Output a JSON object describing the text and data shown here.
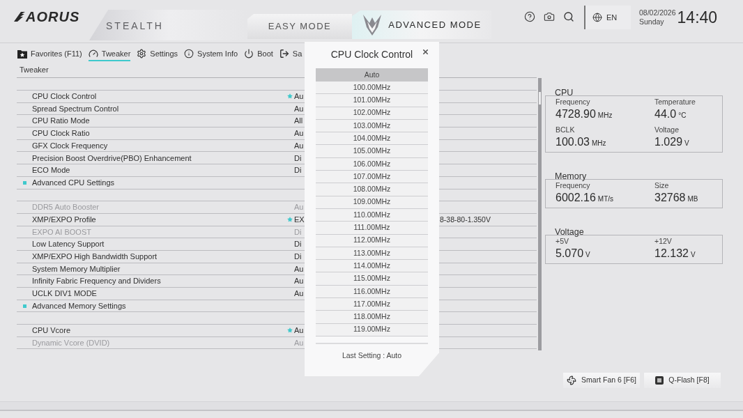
{
  "header": {
    "logo": "AORUS",
    "edition": "STEALTH",
    "modes": [
      {
        "label": "EASY MODE",
        "selected": false
      },
      {
        "label": "ADVANCED MODE",
        "selected": true
      }
    ],
    "language": "EN",
    "date": "08/02/2026",
    "weekday": "Sunday",
    "time": "14:40"
  },
  "nav_tabs": [
    {
      "kind": "favorites",
      "label": "Favorites (F11)",
      "selected": false
    },
    {
      "kind": "tweaker",
      "label": "Tweaker",
      "selected": true
    },
    {
      "kind": "settings",
      "label": "Settings",
      "selected": false
    },
    {
      "kind": "info",
      "label": "System Info",
      "selected": false
    },
    {
      "kind": "boot",
      "label": "Boot",
      "selected": false
    },
    {
      "kind": "exit",
      "label": "Sa",
      "selected": false
    }
  ],
  "breadcrumb": "Tweaker",
  "settings": [
    {
      "kind": "setting",
      "label": "CPU Clock Control",
      "value": "Au",
      "starred": true,
      "disabled": false
    },
    {
      "kind": "setting",
      "label": "Spread Spectrum Control",
      "value": "Au",
      "starred": false,
      "disabled": false
    },
    {
      "kind": "setting",
      "label": "CPU Ratio Mode",
      "value": "All",
      "starred": false,
      "disabled": false
    },
    {
      "kind": "setting",
      "label": "CPU Clock Ratio",
      "value": "Au",
      "starred": false,
      "disabled": false
    },
    {
      "kind": "setting",
      "label": "GFX Clock Frequency",
      "value": "Au",
      "starred": false,
      "disabled": false
    },
    {
      "kind": "setting",
      "label": "Precision Boost Overdrive(PBO) Enhancement",
      "value": "Di",
      "starred": false,
      "disabled": false
    },
    {
      "kind": "setting",
      "label": "ECO Mode",
      "value": "Di",
      "starred": false,
      "disabled": false
    },
    {
      "kind": "submenu",
      "label": "Advanced CPU Settings",
      "disabled": false
    },
    {
      "kind": "spacer"
    },
    {
      "kind": "setting",
      "label": "DDR5 Auto Booster",
      "value": "Au",
      "starred": false,
      "disabled": true
    },
    {
      "kind": "setting",
      "label": "XMP/EXPO Profile",
      "value": "EX",
      "value_tail": "8-38-80-1.350V",
      "starred": true,
      "disabled": false
    },
    {
      "kind": "setting",
      "label": "EXPO AI BOOST",
      "value": "Di",
      "starred": false,
      "disabled": true
    },
    {
      "kind": "setting",
      "label": "Low Latency Support",
      "value": "Di",
      "starred": false,
      "disabled": false
    },
    {
      "kind": "setting",
      "label": "XMP/EXPO High Bandwidth Support",
      "value": "Di",
      "starred": false,
      "disabled": false
    },
    {
      "kind": "setting",
      "label": "System Memory Multiplier",
      "value": "Au",
      "starred": false,
      "disabled": false
    },
    {
      "kind": "setting",
      "label": "Infinity Fabric Frequency and Dividers",
      "value": "Au",
      "starred": false,
      "disabled": false
    },
    {
      "kind": "setting",
      "label": "UCLK DIV1 MODE",
      "value": "Au",
      "starred": false,
      "disabled": false
    },
    {
      "kind": "submenu",
      "label": "Advanced Memory Settings",
      "disabled": false
    },
    {
      "kind": "spacer"
    },
    {
      "kind": "setting",
      "label": "CPU Vcore",
      "value": "Au",
      "starred": true,
      "disabled": false
    },
    {
      "kind": "setting",
      "label": "Dynamic Vcore (DVID)",
      "value": "Au",
      "starred": false,
      "disabled": true
    }
  ],
  "dialog": {
    "title": "CPU Clock Control",
    "options": [
      {
        "label": "Auto",
        "selected": true
      },
      {
        "label": "100.00MHz",
        "selected": false
      },
      {
        "label": "101.00MHz",
        "selected": false
      },
      {
        "label": "102.00MHz",
        "selected": false
      },
      {
        "label": "103.00MHz",
        "selected": false
      },
      {
        "label": "104.00MHz",
        "selected": false
      },
      {
        "label": "105.00MHz",
        "selected": false
      },
      {
        "label": "106.00MHz",
        "selected": false
      },
      {
        "label": "107.00MHz",
        "selected": false
      },
      {
        "label": "108.00MHz",
        "selected": false
      },
      {
        "label": "109.00MHz",
        "selected": false
      },
      {
        "label": "110.00MHz",
        "selected": false
      },
      {
        "label": "111.00MHz",
        "selected": false
      },
      {
        "label": "112.00MHz",
        "selected": false
      },
      {
        "label": "113.00MHz",
        "selected": false
      },
      {
        "label": "114.00MHz",
        "selected": false
      },
      {
        "label": "115.00MHz",
        "selected": false
      },
      {
        "label": "116.00MHz",
        "selected": false
      },
      {
        "label": "117.00MHz",
        "selected": false
      },
      {
        "label": "118.00MHz",
        "selected": false
      },
      {
        "label": "119.00MHz",
        "selected": false
      }
    ],
    "last_setting": "Last Setting : Auto"
  },
  "monitor": [
    {
      "title": "CPU",
      "readings": [
        {
          "label": "Frequency",
          "value": "4728.90",
          "unit": "MHz"
        },
        {
          "label": "Temperature",
          "value": "44.0",
          "unit": "°C"
        },
        {
          "label": "BCLK",
          "value": "100.03",
          "unit": "MHz"
        },
        {
          "label": "Voltage",
          "value": "1.029",
          "unit": "V"
        }
      ]
    },
    {
      "title": "Memory",
      "readings": [
        {
          "label": "Frequency",
          "value": "6002.16",
          "unit": "MT/s"
        },
        {
          "label": "Size",
          "value": "32768",
          "unit": "MB"
        }
      ]
    },
    {
      "title": "Voltage",
      "readings": [
        {
          "label": "+5V",
          "value": "5.070",
          "unit": "V"
        },
        {
          "label": "+12V",
          "value": "12.132",
          "unit": "V"
        }
      ]
    }
  ],
  "shortcuts": [
    {
      "kind": "fan",
      "label": "Smart Fan 6 [F6]"
    },
    {
      "kind": "flash",
      "label": "Q-Flash [F8]"
    }
  ]
}
